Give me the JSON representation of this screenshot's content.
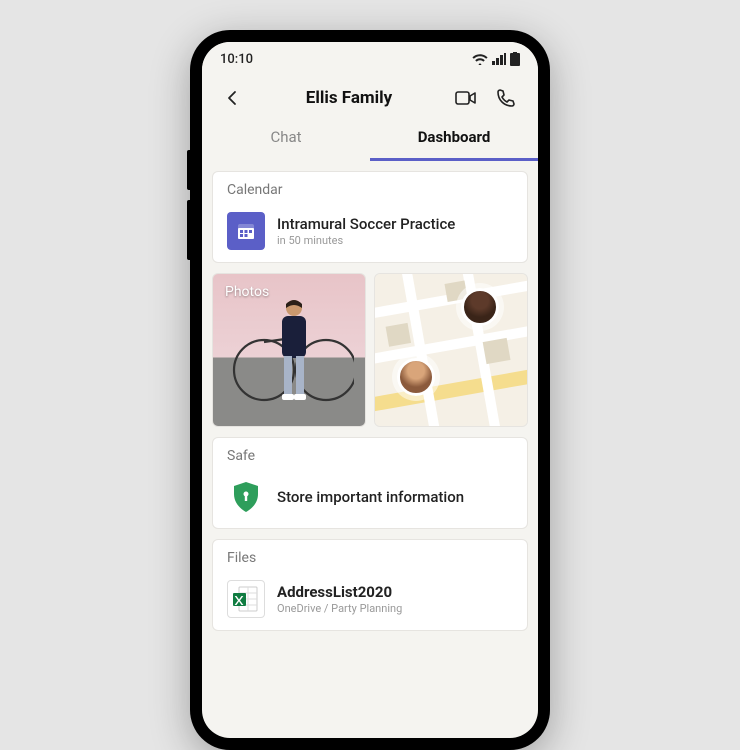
{
  "status": {
    "time": "10:10"
  },
  "header": {
    "title": "Ellis Family"
  },
  "tabs": {
    "chat": "Chat",
    "dashboard": "Dashboard"
  },
  "calendar": {
    "heading": "Calendar",
    "event_title": "Intramural Soccer Practice",
    "event_time": "in 50 minutes"
  },
  "photos": {
    "label": "Photos"
  },
  "safe": {
    "heading": "Safe",
    "text": "Store important information"
  },
  "files": {
    "heading": "Files",
    "file_name": "AddressList2020",
    "file_sub": "OneDrive / Party Planning"
  }
}
